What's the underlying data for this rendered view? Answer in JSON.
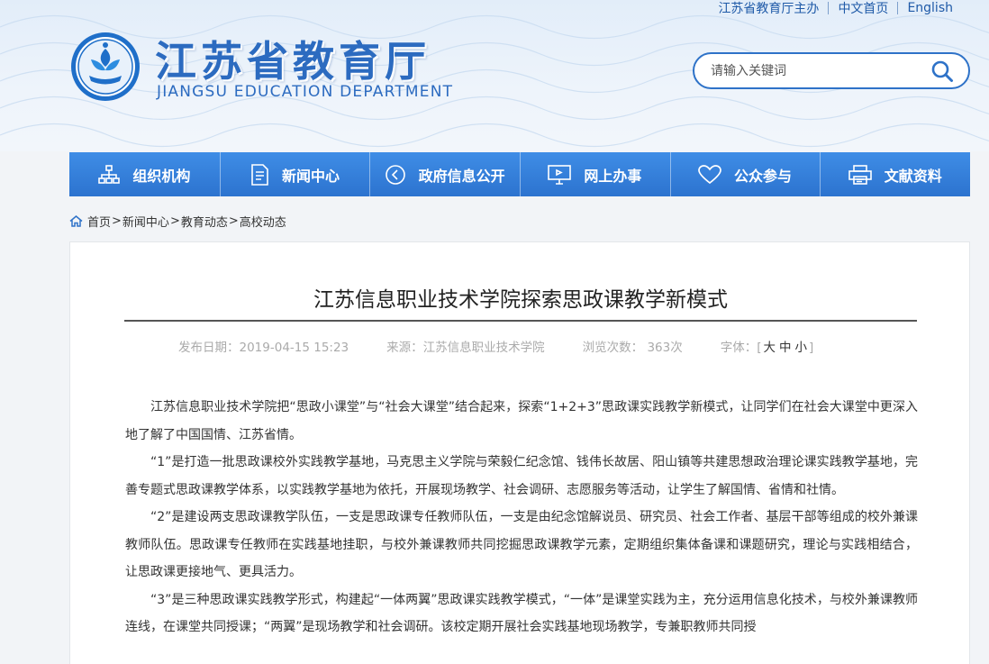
{
  "top_links": {
    "sponsor": "江苏省教育厅主办",
    "home_cn": "中文首页",
    "english": "English"
  },
  "header": {
    "title": "江苏省教育厅",
    "subtitle": "JIANGSU EDUCATION DEPARTMENT",
    "logo_icon": "jiangsu-education-emblem"
  },
  "search": {
    "placeholder": "请输入关键词",
    "icon": "search-icon"
  },
  "nav": {
    "items": [
      {
        "label": "组织机构",
        "icon": "org-chart-icon"
      },
      {
        "label": "新闻中心",
        "icon": "news-document-icon"
      },
      {
        "label": "政府信息公开",
        "icon": "public-info-icon"
      },
      {
        "label": "网上办事",
        "icon": "online-service-monitor-icon"
      },
      {
        "label": "公众参与",
        "icon": "heart-icon"
      },
      {
        "label": "文献资料",
        "icon": "archive-printer-icon"
      }
    ]
  },
  "breadcrumb": {
    "icon": "home-icon",
    "items": [
      "首页",
      "新闻中心",
      "教育动态",
      "高校动态"
    ],
    "separator": ">"
  },
  "article": {
    "title": "江苏信息职业技术学院探索思政课教学新模式",
    "publish_date": "发布日期：2019-04-15 15:23",
    "source": "来源：江苏信息职业技术学院",
    "views": "浏览次数： 363次",
    "font_size_label": "字体：",
    "font_size_open": "[",
    "font_size_options": [
      "大",
      "中",
      "小"
    ],
    "font_size_close": "]",
    "paragraphs": [
      "江苏信息职业技术学院把“思政小课堂”与“社会大课堂”结合起来，探索“1+2+3”思政课实践教学新模式，让同学们在社会大课堂中更深入地了解了中国国情、江苏省情。",
      "“1”是打造一批思政课校外实践教学基地，马克思主义学院与荣毅仁纪念馆、钱伟长故居、阳山镇等共建思想政治理论课实践教学基地，完善专题式思政课教学体系，以实践教学基地为依托，开展现场教学、社会调研、志愿服务等活动，让学生了解国情、省情和社情。",
      "“2”是建设两支思政课教学队伍，一支是思政课专任教师队伍，一支是由纪念馆解说员、研究员、社会工作者、基层干部等组成的校外兼课教师队伍。思政课专任教师在实践基地挂职，与校外兼课教师共同挖掘思政课教学元素，定期组织集体备课和课题研究，理论与实践相结合，让思政课更接地气、更具活力。",
      "“3”是三种思政课实践教学形式，构建起“一体两翼”思政课实践教学模式，“一体”是课堂实践为主，充分运用信息化技术，与校外兼课教师连线，在课堂共同授课；“两翼”是现场教学和社会调研。该校定期开展社会实践基地现场教学，专兼职教师共同授"
    ]
  },
  "colors": {
    "brand_blue": "#2c73cf",
    "nav_top": "#3f8de6",
    "title_blue": "#2c6bc0",
    "page_bg": "#f2f4f7"
  }
}
